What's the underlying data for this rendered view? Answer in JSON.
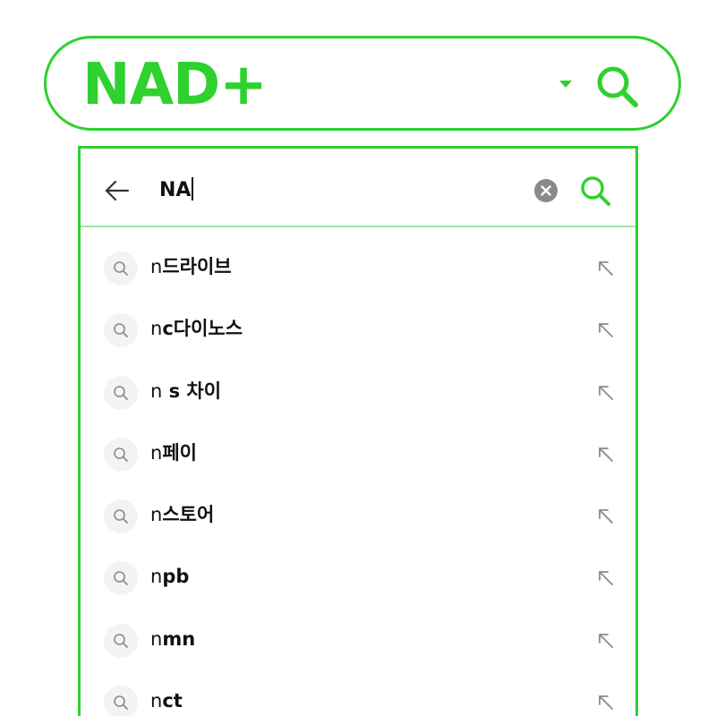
{
  "header": {
    "brand": "NAD+",
    "dropdown_icon": "caret-down-icon",
    "search_icon": "search-icon"
  },
  "search_panel": {
    "back_icon": "back-arrow-icon",
    "query": "NA",
    "clear_icon": "clear-icon",
    "search_icon": "search-icon"
  },
  "suggestions": [
    {
      "label": "n드라이브",
      "icon": "search-icon",
      "fill_icon": "arrow-up-left-icon"
    },
    {
      "label": "nc다이노스",
      "icon": "search-icon",
      "fill_icon": "arrow-up-left-icon"
    },
    {
      "label": "n s 차이",
      "icon": "search-icon",
      "fill_icon": "arrow-up-left-icon"
    },
    {
      "label": "n페이",
      "icon": "search-icon",
      "fill_icon": "arrow-up-left-icon"
    },
    {
      "label": "n스토어",
      "icon": "search-icon",
      "fill_icon": "arrow-up-left-icon"
    },
    {
      "label": "npb",
      "icon": "search-icon",
      "fill_icon": "arrow-up-left-icon"
    },
    {
      "label": "nmn",
      "icon": "search-icon",
      "fill_icon": "arrow-up-left-icon"
    },
    {
      "label": "nct",
      "icon": "search-icon",
      "fill_icon": "arrow-up-left-icon"
    }
  ],
  "colors": {
    "accent": "#2ed12e",
    "divider": "#9fe39f",
    "text": "#111111",
    "muted": "#8a8a8a"
  }
}
